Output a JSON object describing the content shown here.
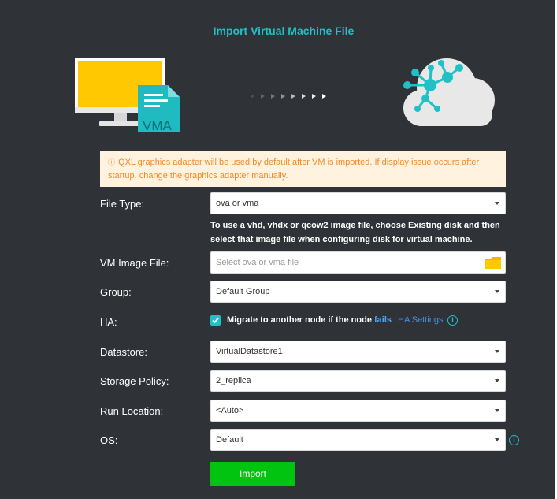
{
  "title": "Import Virtual Machine File",
  "illustration": {
    "file_badge_text": "VMA",
    "computer_icon": "monitor-icon",
    "cloud_icon": "cloud-network-icon",
    "arrow_icon": "transfer-arrows-icon"
  },
  "notice": {
    "icon": "info-circle-icon",
    "text": "QXL graphics adapter will be used by default after VM is imported. If display issue occurs after startup, change the graphics adapter manually."
  },
  "form": {
    "file_type": {
      "label": "File Type:",
      "value": "ova or vma"
    },
    "file_type_hint": "To use a vhd, vhdx or qcow2 image file, choose Existing disk and then select that image file when configuring disk for virtual machine.",
    "vm_image_file": {
      "label": "VM Image File:",
      "placeholder": "Select ova or vma file",
      "icon": "folder-icon"
    },
    "group": {
      "label": "Group:",
      "value": "Default Group"
    },
    "ha": {
      "label": "HA:",
      "checked": true,
      "checkbox_text": "Migrate to another node if the node ",
      "checkbox_link": "fails",
      "settings_link": "HA Settings"
    },
    "datastore": {
      "label": "Datastore:",
      "value": "VirtualDatastore1"
    },
    "storage_policy": {
      "label": "Storage Policy:",
      "value": "2_replica"
    },
    "run_location": {
      "label": "Run Location:",
      "value": "<Auto>"
    },
    "os": {
      "label": "OS:",
      "value": "Default"
    }
  },
  "import_button": "Import",
  "colors": {
    "background": "#2f3237",
    "accent": "#1fc1c6",
    "notice_bg": "#fff3e0",
    "notice_text": "#f08a2a",
    "button": "#00c40f",
    "link": "#4a90e2",
    "monitor_screen": "#ffc800"
  }
}
